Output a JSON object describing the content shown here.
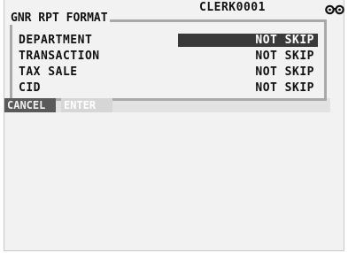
{
  "header": {
    "clerk": "CLERK0001",
    "status_icon": "glasses-icon"
  },
  "panel": {
    "title": "GNR RPT FORMAT",
    "rows": [
      {
        "label": "DEPARTMENT",
        "value": "NOT SKIP",
        "selected": true
      },
      {
        "label": "TRANSACTION",
        "value": "NOT SKIP",
        "selected": false
      },
      {
        "label": "TAX SALE",
        "value": "NOT SKIP",
        "selected": false
      },
      {
        "label": "CID",
        "value": "NOT SKIP",
        "selected": false
      }
    ]
  },
  "softkeys": {
    "cancel": "CANCEL",
    "enter": "ENTER"
  },
  "colors": {
    "background": "#f2f2f2",
    "frame": "#a9a9a9",
    "selection": "#3a3a3a",
    "cancel_key": "#5a5a5a",
    "enter_key": "#d6d6d6"
  }
}
